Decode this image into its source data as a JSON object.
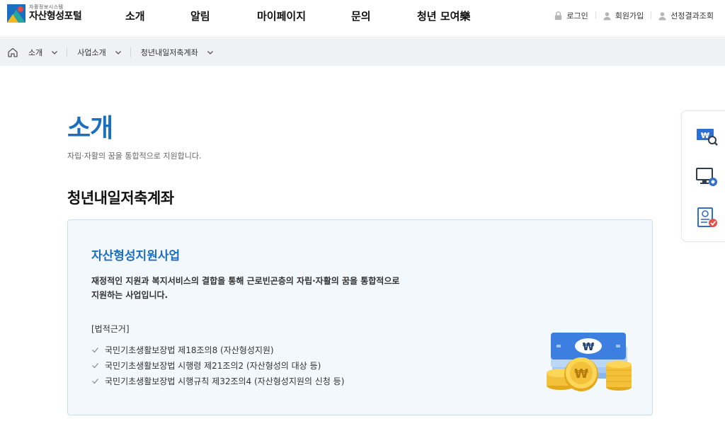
{
  "header": {
    "logo_sub": "자활정보시스템",
    "logo_main": "자산형성포털",
    "nav": [
      "소개",
      "알림",
      "마이페이지",
      "문의",
      "청년 모여樂"
    ],
    "util": [
      {
        "label": "로그인",
        "icon": "lock-icon"
      },
      {
        "label": "회원가입",
        "icon": "user-icon"
      },
      {
        "label": "선정결과조회",
        "icon": "user-icon"
      }
    ]
  },
  "breadcrumb": {
    "items": [
      "소개",
      "사업소개",
      "청년내일저축계좌"
    ]
  },
  "page": {
    "title": "소개",
    "subtitle": "자립·자활의 꿈을 통합적으로 지원합니다.",
    "section_title": "청년내일저축계좌"
  },
  "card": {
    "title": "자산형성지원사업",
    "desc_line1": "재정적인 지원과 복지서비스의 결합을 통해 근로빈곤층의 자립·자활의 꿈을 통합적으로",
    "desc_line2": "지원하는 사업입니다.",
    "law_title": "[법적근거]",
    "laws": [
      "국민기초생활보장법 제18조의8 (자산형성지원)",
      "국민기초생활보장법 시행령 제21조의2 (자산형성의 대상 등)",
      "국민기초생활보장법 시행규칙 제32조의4 (자산형성지원의 신청 등)"
    ]
  },
  "quick_menu": [
    {
      "icon": "money-search-icon"
    },
    {
      "icon": "monitor-settings-icon"
    },
    {
      "icon": "document-check-icon"
    }
  ],
  "colors": {
    "brand_blue": "#1a6fc1",
    "breadcrumb_bg": "#eef2f2",
    "card_bg": "#f3f8fc",
    "card_border": "#c8dcee"
  }
}
